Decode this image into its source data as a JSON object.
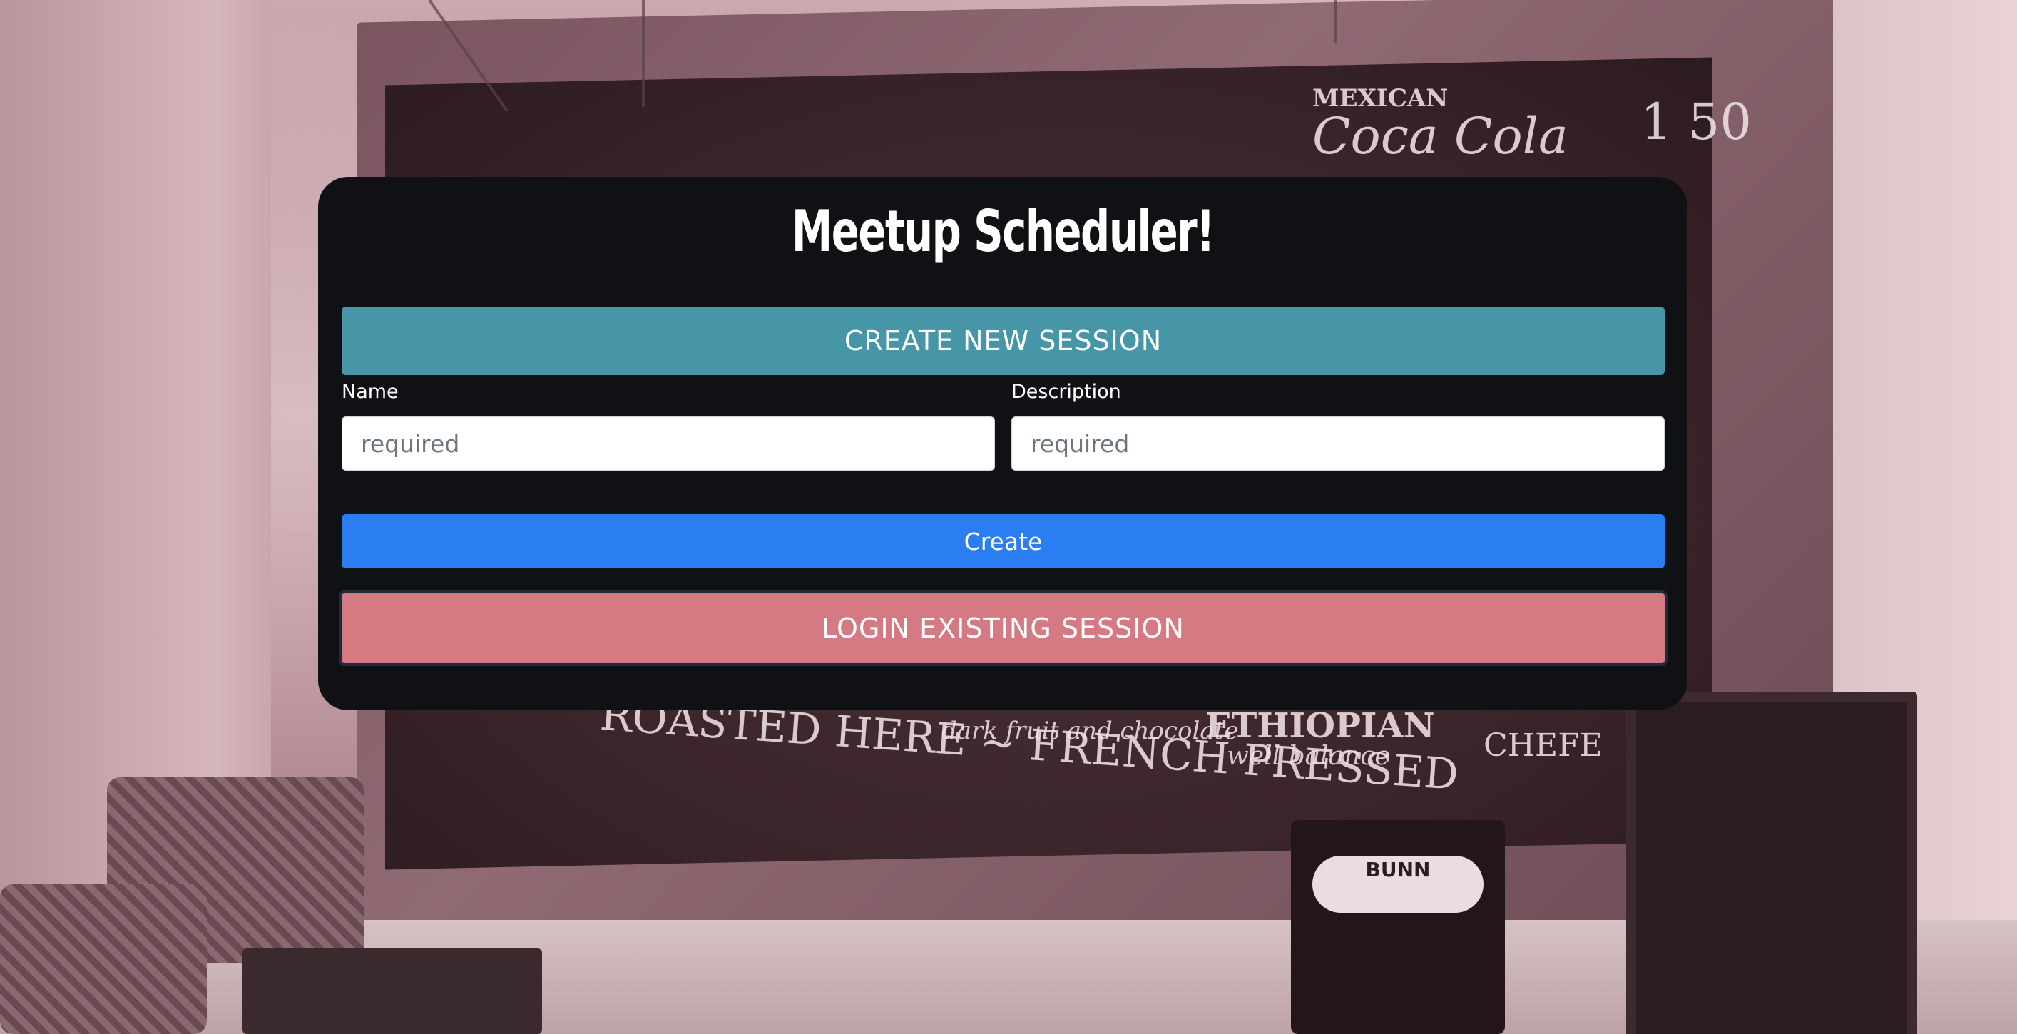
{
  "app": {
    "title": "Meetup Scheduler!"
  },
  "create_session": {
    "header_label": "CREATE NEW SESSION",
    "name_label": "Name",
    "name_placeholder": "required",
    "name_value": "",
    "description_label": "Description",
    "description_placeholder": "required",
    "description_value": "",
    "create_button_label": "Create"
  },
  "login_session": {
    "header_label": "LOGIN EXISTING SESSION"
  },
  "background": {
    "board_text_1": "MEXICAN",
    "board_text_2": "Coca Cola",
    "board_text_3": "1 50",
    "board_text_4": "ROASTED HERE ~ FRENCH PRESSED",
    "board_text_5": "ETHIOPIAN",
    "board_text_6": "dark fruit and chocolate",
    "board_text_7": "well balance",
    "board_text_8": "CHEFE",
    "grinder_brand": "BUNN"
  },
  "colors": {
    "panel_bg": "#101114",
    "create_session_teal": "#4696a8",
    "create_button_blue": "#2b7ef2",
    "login_session_pink": "#d57982"
  }
}
